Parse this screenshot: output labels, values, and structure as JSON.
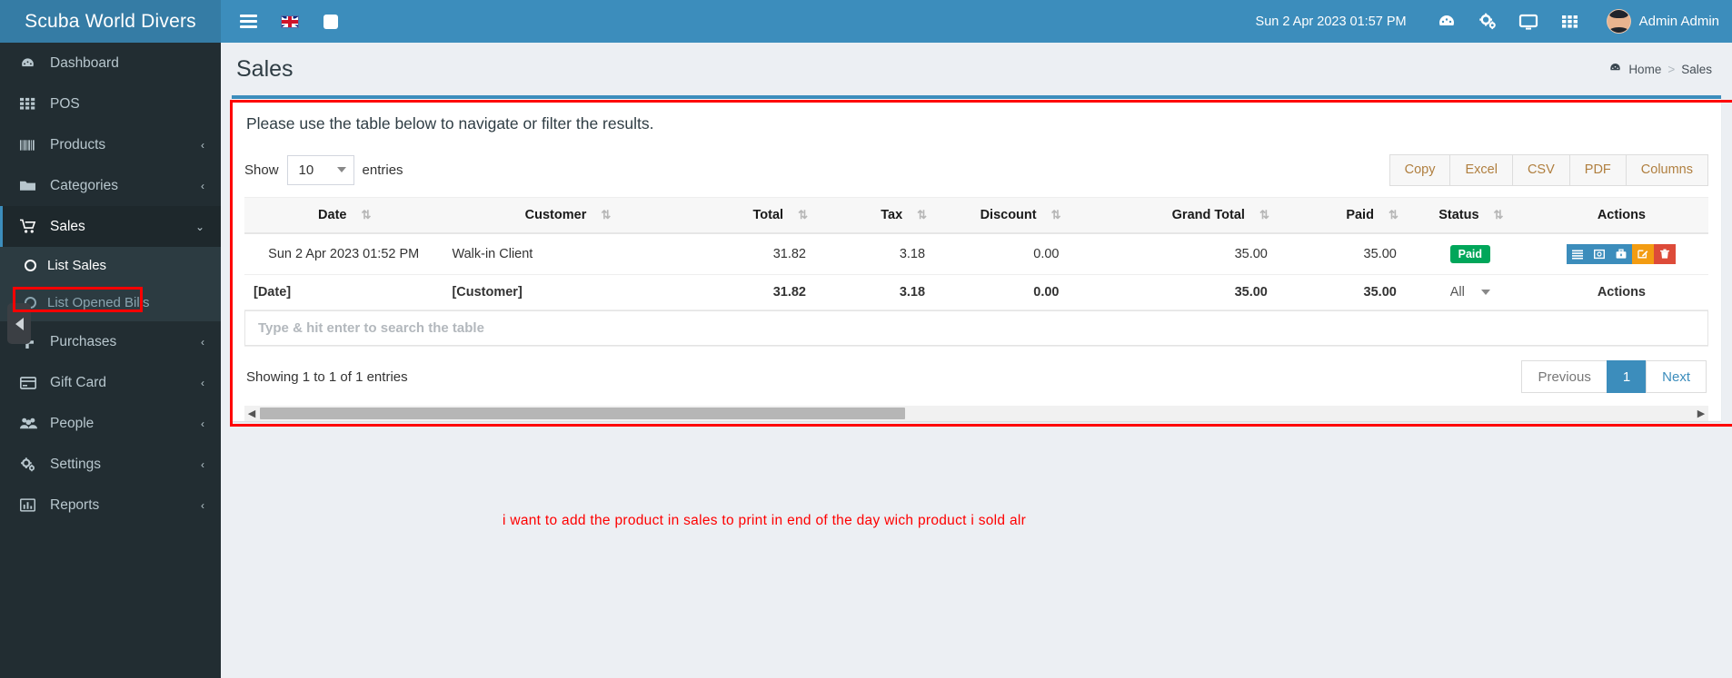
{
  "topbar": {
    "brand": "Scuba World Divers",
    "menu_toggle": "☰",
    "language": "en-GB",
    "datetime": "Sun 2 Apr 2023 01:57 PM",
    "user_name": "Admin Admin",
    "icons": [
      "dashboard-icon",
      "gears-icon",
      "screen-icon",
      "grid-icon"
    ]
  },
  "sidebar": {
    "items": [
      {
        "label": "Dashboard",
        "icon": "dashboard-icon",
        "arrow": ""
      },
      {
        "label": "POS",
        "icon": "grid-icon",
        "arrow": ""
      },
      {
        "label": "Products",
        "icon": "barcode-icon",
        "arrow": "‹"
      },
      {
        "label": "Categories",
        "icon": "folder-icon",
        "arrow": "‹"
      },
      {
        "label": "Sales",
        "icon": "cart-icon",
        "arrow": "⌄"
      },
      {
        "label": "Purchases",
        "icon": "plus-icon",
        "arrow": "‹"
      },
      {
        "label": "Gift Card",
        "icon": "credit-card-icon",
        "arrow": "‹"
      },
      {
        "label": "People",
        "icon": "people-icon",
        "arrow": "‹"
      },
      {
        "label": "Settings",
        "icon": "gears-icon",
        "arrow": "‹"
      },
      {
        "label": "Reports",
        "icon": "chart-icon",
        "arrow": "‹"
      }
    ],
    "submenu": [
      {
        "label": "List Sales",
        "selected": true
      },
      {
        "label": "List Opened Bills",
        "selected": false
      }
    ]
  },
  "page": {
    "title": "Sales",
    "breadcrumb_home": "Home",
    "breadcrumb_sep": ">",
    "breadcrumb_current": "Sales",
    "lead": "Please use the table below to navigate or filter the results."
  },
  "datatable": {
    "show_label": "Show",
    "page_length": "10",
    "entries_label": "entries",
    "buttons": [
      "Copy",
      "Excel",
      "CSV",
      "PDF",
      "Columns"
    ],
    "columns": [
      "Date",
      "Customer",
      "Total",
      "Tax",
      "Discount",
      "Grand Total",
      "Paid",
      "Status",
      "Actions"
    ],
    "rows": [
      {
        "date": "Sun 2 Apr 2023 01:52 PM",
        "customer": "Walk-in Client",
        "total": "31.82",
        "tax": "3.18",
        "discount": "0.00",
        "grand_total": "35.00",
        "paid": "35.00",
        "status": "Paid",
        "actions": [
          "list-icon",
          "payment-icon",
          "briefcase-icon",
          "edit-icon",
          "delete-icon"
        ]
      }
    ],
    "footer_filters": {
      "date": "[Date]",
      "customer": "[Customer]",
      "total": "31.82",
      "tax": "3.18",
      "discount": "0.00",
      "grand_total": "35.00",
      "paid": "35.00",
      "status": "All",
      "actions": "Actions"
    },
    "search_placeholder": "Type & hit enter to search the table",
    "info": "Showing 1 to 1 of 1 entries",
    "pagination": {
      "previous": "Previous",
      "pages": [
        "1"
      ],
      "next": "Next",
      "current": "1"
    }
  },
  "annotation": {
    "note": "i want to add  the  product in sales   to print  in end  of the  day  wich  product i sold alr"
  },
  "colors": {
    "brand_blue": "#3c8dbc",
    "brand_blue_dark": "#357ca5",
    "sidebar_dark": "#222d32",
    "submenu": "#2c3b41",
    "success_green": "#00a65a",
    "warning_orange": "#f39c12",
    "danger_red": "#dd4b39",
    "annotation_red": "#fe0000"
  }
}
